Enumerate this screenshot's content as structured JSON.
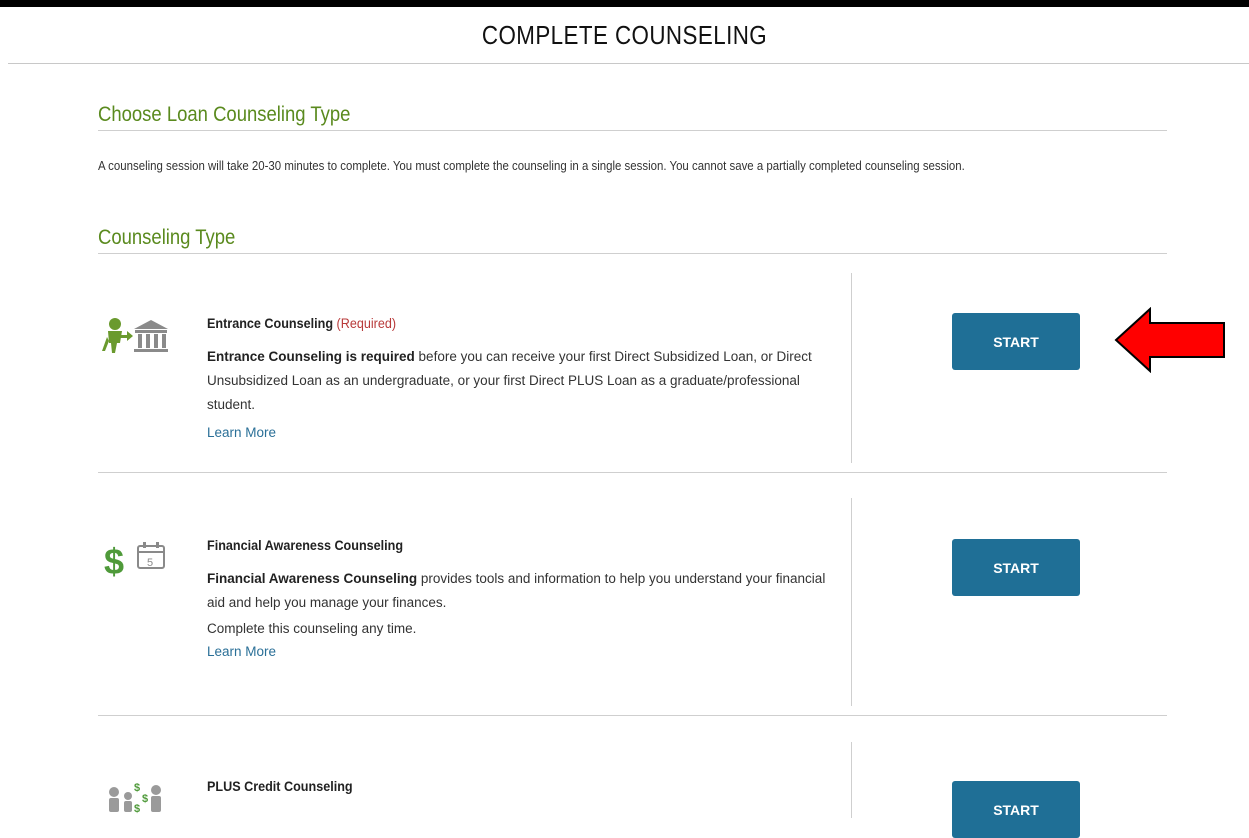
{
  "page": {
    "title": "COMPLETE COUNSELING"
  },
  "intro": {
    "heading": "Choose Loan Counseling Type",
    "text": "A counseling session will take 20-30 minutes to complete. You must complete the counseling in a single session. You cannot save a partially completed counseling session."
  },
  "counseling": {
    "heading": "Counseling Type",
    "items": [
      {
        "title": "Entrance Counseling",
        "badge": "(Required)",
        "desc_bold": "Entrance Counseling is required",
        "desc_rest": " before you can receive your first Direct Subsidized Loan, or Direct Unsubsidized Loan as an undergraduate, or your first Direct PLUS Loan as a graduate/professional student.",
        "note": "",
        "learn_more": "Learn More",
        "button": "START",
        "icon": "student-bank-icon"
      },
      {
        "title": "Financial Awareness Counseling",
        "badge": "",
        "desc_bold": "Financial Awareness Counseling",
        "desc_rest": " provides tools and information to help you understand your financial aid and help you manage your finances.",
        "note": "Complete this counseling any time.",
        "learn_more": "Learn More",
        "button": "START",
        "icon": "dollar-calendar-icon",
        "calendar_day": "5"
      },
      {
        "title": "PLUS Credit Counseling",
        "badge": "",
        "button": "START",
        "icon": "family-money-icon"
      }
    ]
  },
  "colors": {
    "heading_green": "#5a8a1e",
    "button_blue": "#1f6f96",
    "required_red": "#b83a3a",
    "arrow_red": "#ff0000"
  }
}
